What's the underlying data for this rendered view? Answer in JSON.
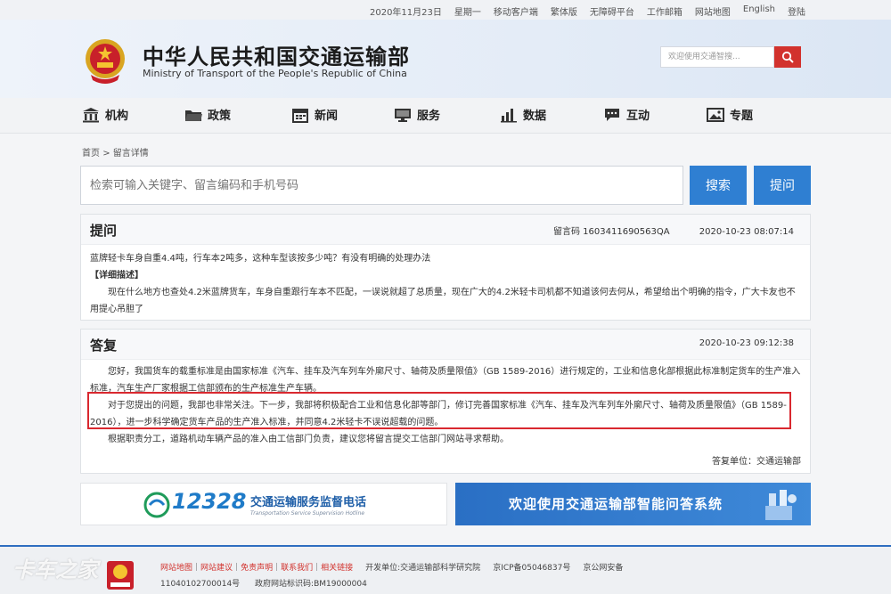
{
  "topbar": {
    "date": "2020年11月23日",
    "weekday": "星期一",
    "items": [
      "移动客户端",
      "繁体版",
      "无障碍平台",
      "工作邮箱",
      "网站地图",
      "English",
      "登陆"
    ]
  },
  "header": {
    "title": "中华人民共和国交通运输部",
    "subtitle": "Ministry of Transport of the People's Republic of China",
    "search_placeholder": "欢迎使用交通智搜..."
  },
  "nav": {
    "items": [
      {
        "label": "机构",
        "icon": "building-icon"
      },
      {
        "label": "政策",
        "icon": "folder-icon"
      },
      {
        "label": "新闻",
        "icon": "calendar-icon"
      },
      {
        "label": "服务",
        "icon": "monitor-icon"
      },
      {
        "label": "数据",
        "icon": "bar-chart-icon"
      },
      {
        "label": "互动",
        "icon": "chat-icon"
      },
      {
        "label": "专题",
        "icon": "image-icon"
      }
    ]
  },
  "breadcrumb": {
    "home": "首页",
    "sep": ">",
    "current": "留言详情"
  },
  "search": {
    "placeholder": "检索可输入关键字、留言编码和手机号码",
    "search_label": "搜索",
    "ask_label": "提问"
  },
  "question": {
    "title": "提问",
    "code_label": "留言码",
    "code": "1603411690563QA",
    "time": "2020-10-23 08:07:14",
    "subject": "蓝牌轻卡车身自重4.4吨，行车本2吨多，这种车型该按多少吨？有没有明确的处理办法",
    "detail_tag": "【详细描述】",
    "detail": "现在什么地方也查处4.2米蓝牌货车，车身自重跟行车本不匹配，一误说就超了总质量，现在广大的4.2米轻卡司机都不知道该何去何从，希望给出个明确的指令，广大卡友也不用提心吊胆了"
  },
  "answer": {
    "title": "答复",
    "time": "2020-10-23 09:12:38",
    "p1": "您好，我国货车的载重标准是由国家标准《汽车、挂车及汽车列车外廓尺寸、轴荷及质量限值》（GB 1589-2016）进行规定的，工业和信息化部根据此标准制定货车的生产准入标准，汽车生产厂家根据工信部颁布的生产标准生产车辆。",
    "p2": "对于您提出的问题，我部也非常关注。下一步，我部将积极配合工业和信息化部等部门，修订完善国家标准《汽车、挂车及汽车列车外廓尺寸、轴荷及质量限值》（GB 1589-2016），进一步科学确定货车产品的生产准入标准，并同意4.2米轻卡不误说超载的问题。",
    "p3": "根据职责分工，道路机动车辆产品的准入由工信部门负责，建议您将留言提交工信部门网站寻求帮助。",
    "unit_label": "答复单位：",
    "unit": "交通运输部"
  },
  "banners": {
    "hotline_number": "12328",
    "hotline_text": "交通运输服务监督电话",
    "hotline_sub": "Transportation Service Supervision Hotline",
    "qa_text": "欢迎使用交通运输部智能问答系统"
  },
  "footer": {
    "links": [
      "网站地图",
      "网站建议",
      "免责声明",
      "联系我们",
      "相关链接"
    ],
    "sponsor": "开发单位:交通运输部科学研究院",
    "icp": "京ICP备05046837号",
    "police": "京公网安备",
    "police_no": "11040102700014号",
    "gov_code": "政府网站标识码:BM19000004"
  },
  "watermark": "卡车之家",
  "colors": {
    "accent_blue": "#2f7fd2",
    "accent_red": "#d2322d",
    "highlight_red": "#d9282f"
  }
}
